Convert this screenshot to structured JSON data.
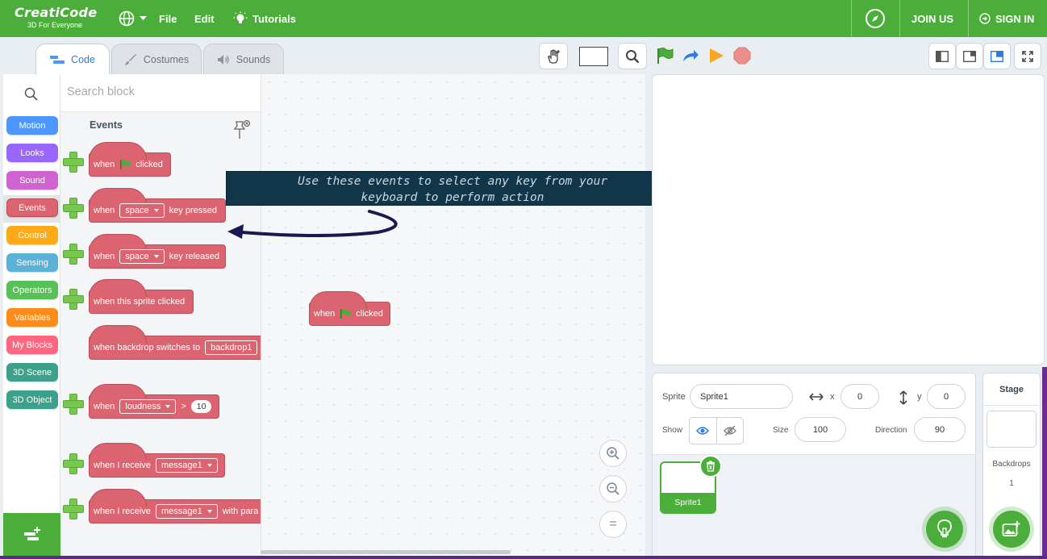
{
  "brand": {
    "name": "CreatiCode",
    "tagline": "3D For Everyone",
    "green": "#4cae3a",
    "event_color": "#db6470"
  },
  "nav": {
    "file": "File",
    "edit": "Edit",
    "tutorials": "Tutorials",
    "join": "JOIN US",
    "signin": "SIGN IN"
  },
  "tabs": [
    {
      "label": "Code",
      "icon": "code-icon",
      "active": true
    },
    {
      "label": "Costumes",
      "icon": "brush-icon"
    },
    {
      "label": "Sounds",
      "icon": "speaker-icon"
    }
  ],
  "categories": [
    {
      "label": "Motion",
      "color": "#4c97ff"
    },
    {
      "label": "Looks",
      "color": "#9966ff"
    },
    {
      "label": "Sound",
      "color": "#cf63cf"
    },
    {
      "label": "Events",
      "color": "#db6470",
      "active": true
    },
    {
      "label": "Control",
      "color": "#ffab19"
    },
    {
      "label": "Sensing",
      "color": "#5cb1d6"
    },
    {
      "label": "Operators",
      "color": "#59c059"
    },
    {
      "label": "Variables",
      "color": "#ff8c1a"
    },
    {
      "label": "My Blocks",
      "color": "#ff6680"
    },
    {
      "label": "3D Scene",
      "color": "#3da08a"
    },
    {
      "label": "3D Object",
      "color": "#3da08a"
    }
  ],
  "palette": {
    "search_placeholder": "Search block",
    "heading": "Events",
    "blocks": {
      "flag_clicked": {
        "when": "when",
        "clicked": "clicked"
      },
      "key_pressed": {
        "when": "when",
        "key": "space",
        "rest": "key pressed"
      },
      "key_released": {
        "when": "when",
        "key": "space",
        "rest": "key released"
      },
      "sprite_clicked": {
        "text": "when this sprite clicked"
      },
      "backdrop": {
        "text": "when backdrop switches to",
        "value": "backdrop1"
      },
      "loudness": {
        "when": "when",
        "sensor": "loudness",
        "op": ">",
        "value": "10"
      },
      "receive1": {
        "text": "when I receive",
        "msg": "message1"
      },
      "receive2": {
        "text": "when I receive",
        "msg": "message1",
        "rest": "with para"
      }
    }
  },
  "tip": {
    "line1": "Use these events to select any key from your",
    "line2": "keyboard to perform action"
  },
  "script_block": {
    "when": "when",
    "clicked": "clicked"
  },
  "zoom": {
    "reset": "="
  },
  "sprite_info": {
    "sprite_label": "Sprite",
    "sprite_name": "Sprite1",
    "x_label": "x",
    "x_value": "0",
    "y_label": "y",
    "y_value": "0",
    "show_label": "Show",
    "size_label": "Size",
    "size_value": "100",
    "direction_label": "Direction",
    "direction_value": "90"
  },
  "sprite_list": [
    {
      "name": "Sprite1"
    }
  ],
  "stage_panel": {
    "title": "Stage",
    "backdrops_label": "Backdrops",
    "backdrops_count": "1"
  }
}
